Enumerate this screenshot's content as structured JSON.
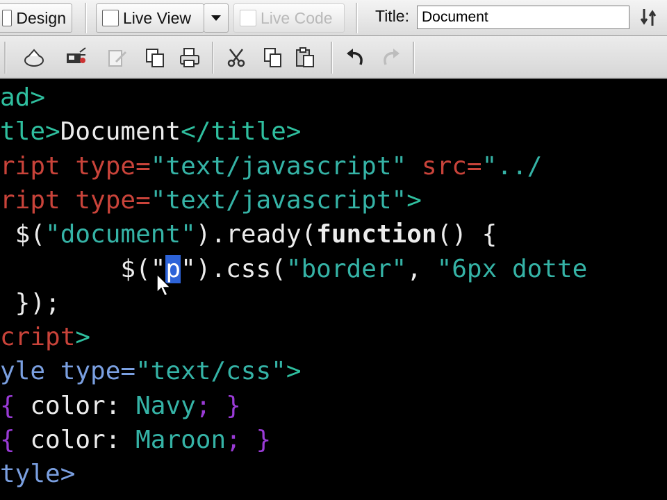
{
  "toolbar": {
    "design_label": "Design",
    "live_view_label": "Live View",
    "live_code_label": "Live Code",
    "title_label": "Title:",
    "title_value": "Document",
    "icons": [
      "site-icon",
      "media-icon",
      "edit-icon",
      "copy-icon",
      "print-icon",
      "cut-icon",
      "duplicate-icon",
      "paste-icon",
      "undo-icon",
      "redo-icon"
    ]
  },
  "code": {
    "lines": [
      {
        "segments": [
          [
            "tag",
            "ad>"
          ]
        ]
      },
      {
        "segments": [
          [
            "tag",
            "tle>"
          ],
          [
            "txt",
            "Document"
          ],
          [
            "tag",
            "</title>"
          ]
        ]
      },
      {
        "segments": [
          [
            "attr",
            "ript type="
          ],
          [
            "str",
            "\"text/javascript\""
          ],
          [
            "attr",
            " src="
          ],
          [
            "str",
            "\"../"
          ]
        ]
      },
      {
        "segments": [
          [
            "attr",
            "ript type="
          ],
          [
            "str",
            "\"text/javascript\""
          ],
          [
            "tag",
            ">"
          ]
        ]
      },
      {
        "segments": [
          [
            "txt",
            " $("
          ],
          [
            "str",
            "\"document\""
          ],
          [
            "txt",
            ").ready("
          ],
          [
            "kw",
            "function"
          ],
          [
            "txt",
            "() {"
          ]
        ]
      },
      {
        "segments": [
          [
            "txt",
            "        $(\""
          ],
          [
            "hl",
            "p"
          ],
          [
            "txt",
            "\").css("
          ],
          [
            "str",
            "\"border\""
          ],
          [
            "txt",
            ", "
          ],
          [
            "str",
            "\"6px dotte"
          ]
        ]
      },
      {
        "segments": [
          [
            "txt",
            " });"
          ]
        ]
      },
      {
        "segments": [
          [
            "attr",
            "cript"
          ],
          [
            "tag",
            ">"
          ]
        ]
      },
      {
        "segments": [
          [
            "css-tag",
            "yle type="
          ],
          [
            "str",
            "\"text/css\""
          ],
          [
            "tag",
            ">"
          ]
        ]
      },
      {
        "segments": [
          [
            "brace",
            "{"
          ],
          [
            "prop",
            " color"
          ],
          [
            "txt",
            ": "
          ],
          [
            "val",
            "Navy"
          ],
          [
            "brace",
            "; }"
          ]
        ]
      },
      {
        "segments": [
          [
            "brace",
            "{"
          ],
          [
            "prop",
            " color"
          ],
          [
            "txt",
            ": "
          ],
          [
            "val",
            "Maroon"
          ],
          [
            "brace",
            "; }"
          ]
        ]
      },
      {
        "segments": [
          [
            "css-tag",
            "tyle>"
          ]
        ]
      }
    ]
  },
  "colors": {
    "editor_bg": "#000000",
    "tag": "#2fbf9f",
    "attribute": "#c9433a",
    "string": "#35b3a6",
    "selection": "#2d63d8",
    "css_brace": "#9a3bd6"
  }
}
